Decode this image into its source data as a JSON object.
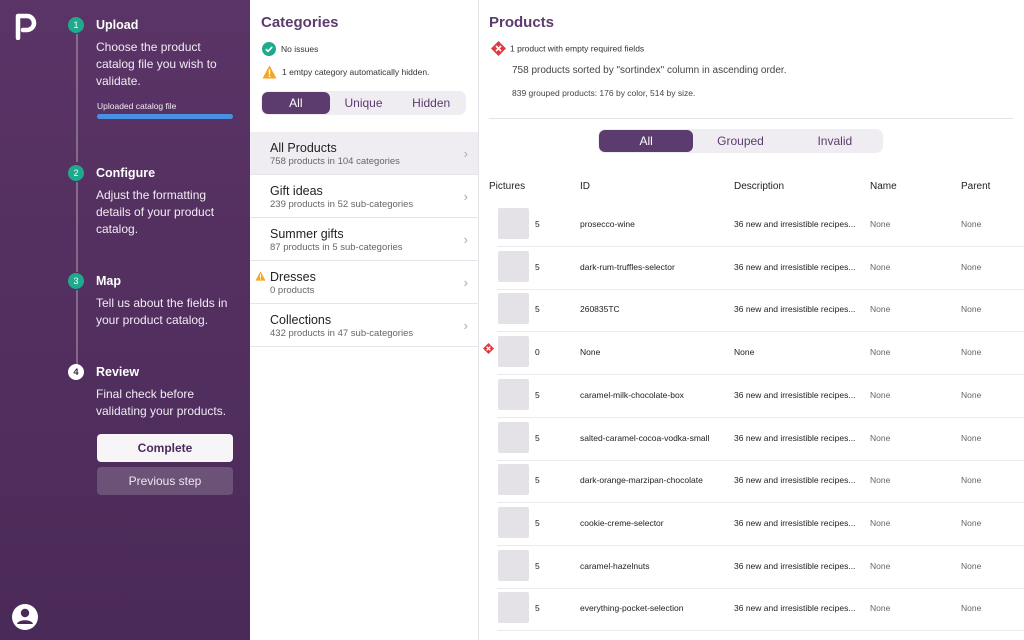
{
  "colors": {
    "brand": "#5c3b6e",
    "sidebar": "#4a2a58",
    "success": "#1fa98d",
    "warning": "#f5a623",
    "error": "#e0393e",
    "progress": "#4a90e2"
  },
  "steps": [
    {
      "num": "1",
      "title": "Upload",
      "desc": "Choose the product catalog file you wish to validate.",
      "status": "done"
    },
    {
      "num": "2",
      "title": "Configure",
      "desc": "Adjust the formatting details of your product catalog.",
      "status": "done"
    },
    {
      "num": "3",
      "title": "Map",
      "desc": "Tell us about the fields in your product catalog.",
      "status": "done"
    },
    {
      "num": "4",
      "title": "Review",
      "desc": "Final check before validating your products.",
      "status": "current"
    }
  ],
  "upload": {
    "label": "Uploaded catalog file",
    "progress": 1.0
  },
  "actions": {
    "complete": "Complete",
    "previous": "Previous step"
  },
  "icons": {
    "logo": "logo-icon",
    "user": "user-icon",
    "check": "check-circle-icon",
    "warning": "warning-icon",
    "error": "error-diamond-icon",
    "chevron": "chevron-right-icon"
  },
  "categories": {
    "title": "Categories",
    "notices": [
      "No issues",
      "1 emtpy category automatically hidden."
    ],
    "filters": [
      "All",
      "Unique",
      "Hidden"
    ],
    "active_filter": "All",
    "items": [
      {
        "name": "All Products",
        "sub": "758 products in 104 categories",
        "selected": true,
        "warning": false
      },
      {
        "name": "Gift ideas",
        "sub": "239 products in 52 sub-categories",
        "selected": false,
        "warning": false
      },
      {
        "name": "Summer gifts",
        "sub": "87 products in 5 sub-categories",
        "selected": false,
        "warning": false
      },
      {
        "name": "Dresses",
        "sub": "0 products",
        "selected": false,
        "warning": true
      },
      {
        "name": "Collections",
        "sub": "432 products in 47 sub-categories",
        "selected": false,
        "warning": false
      }
    ]
  },
  "products": {
    "title": "Products",
    "error": "1 product with empty required fields",
    "sort_info": "758 products sorted by \"sortindex\" column in ascending order.",
    "group_info": "839 grouped products: 176 by color, 514 by size.",
    "filters": [
      "All",
      "Grouped",
      "Invalid"
    ],
    "active_filter": "All",
    "columns": [
      "Pictures",
      "ID",
      "Description",
      "Name",
      "Parent"
    ],
    "rows": [
      {
        "count": "5",
        "id": "prosecco-wine",
        "desc": "36 new and irresistible recipes...",
        "name": "None",
        "parent": "None",
        "error": false
      },
      {
        "count": "5",
        "id": "dark-rum-truffles-selector",
        "desc": "36 new and irresistible recipes...",
        "name": "None",
        "parent": "None",
        "error": false
      },
      {
        "count": "5",
        "id": "260835TC",
        "desc": "36 new and irresistible recipes...",
        "name": "None",
        "parent": "None",
        "error": false
      },
      {
        "count": "0",
        "id": "None",
        "desc": "None",
        "name": "None",
        "parent": "None",
        "error": true
      },
      {
        "count": "5",
        "id": "caramel-milk-chocolate-box",
        "desc": "36 new and irresistible recipes...",
        "name": "None",
        "parent": "None",
        "error": false
      },
      {
        "count": "5",
        "id": "salted-caramel-cocoa-vodka-small",
        "desc": "36 new and irresistible recipes...",
        "name": "None",
        "parent": "None",
        "error": false
      },
      {
        "count": "5",
        "id": "dark-orange-marzipan-chocolate",
        "desc": "36 new and irresistible recipes...",
        "name": "None",
        "parent": "None",
        "error": false
      },
      {
        "count": "5",
        "id": "cookie-creme-selector",
        "desc": "36 new and irresistible recipes...",
        "name": "None",
        "parent": "None",
        "error": false
      },
      {
        "count": "5",
        "id": "caramel-hazelnuts",
        "desc": "36 new and irresistible recipes...",
        "name": "None",
        "parent": "None",
        "error": false
      },
      {
        "count": "5",
        "id": "everything-pocket-selection",
        "desc": "36 new and irresistible recipes...",
        "name": "None",
        "parent": "None",
        "error": false
      }
    ]
  }
}
